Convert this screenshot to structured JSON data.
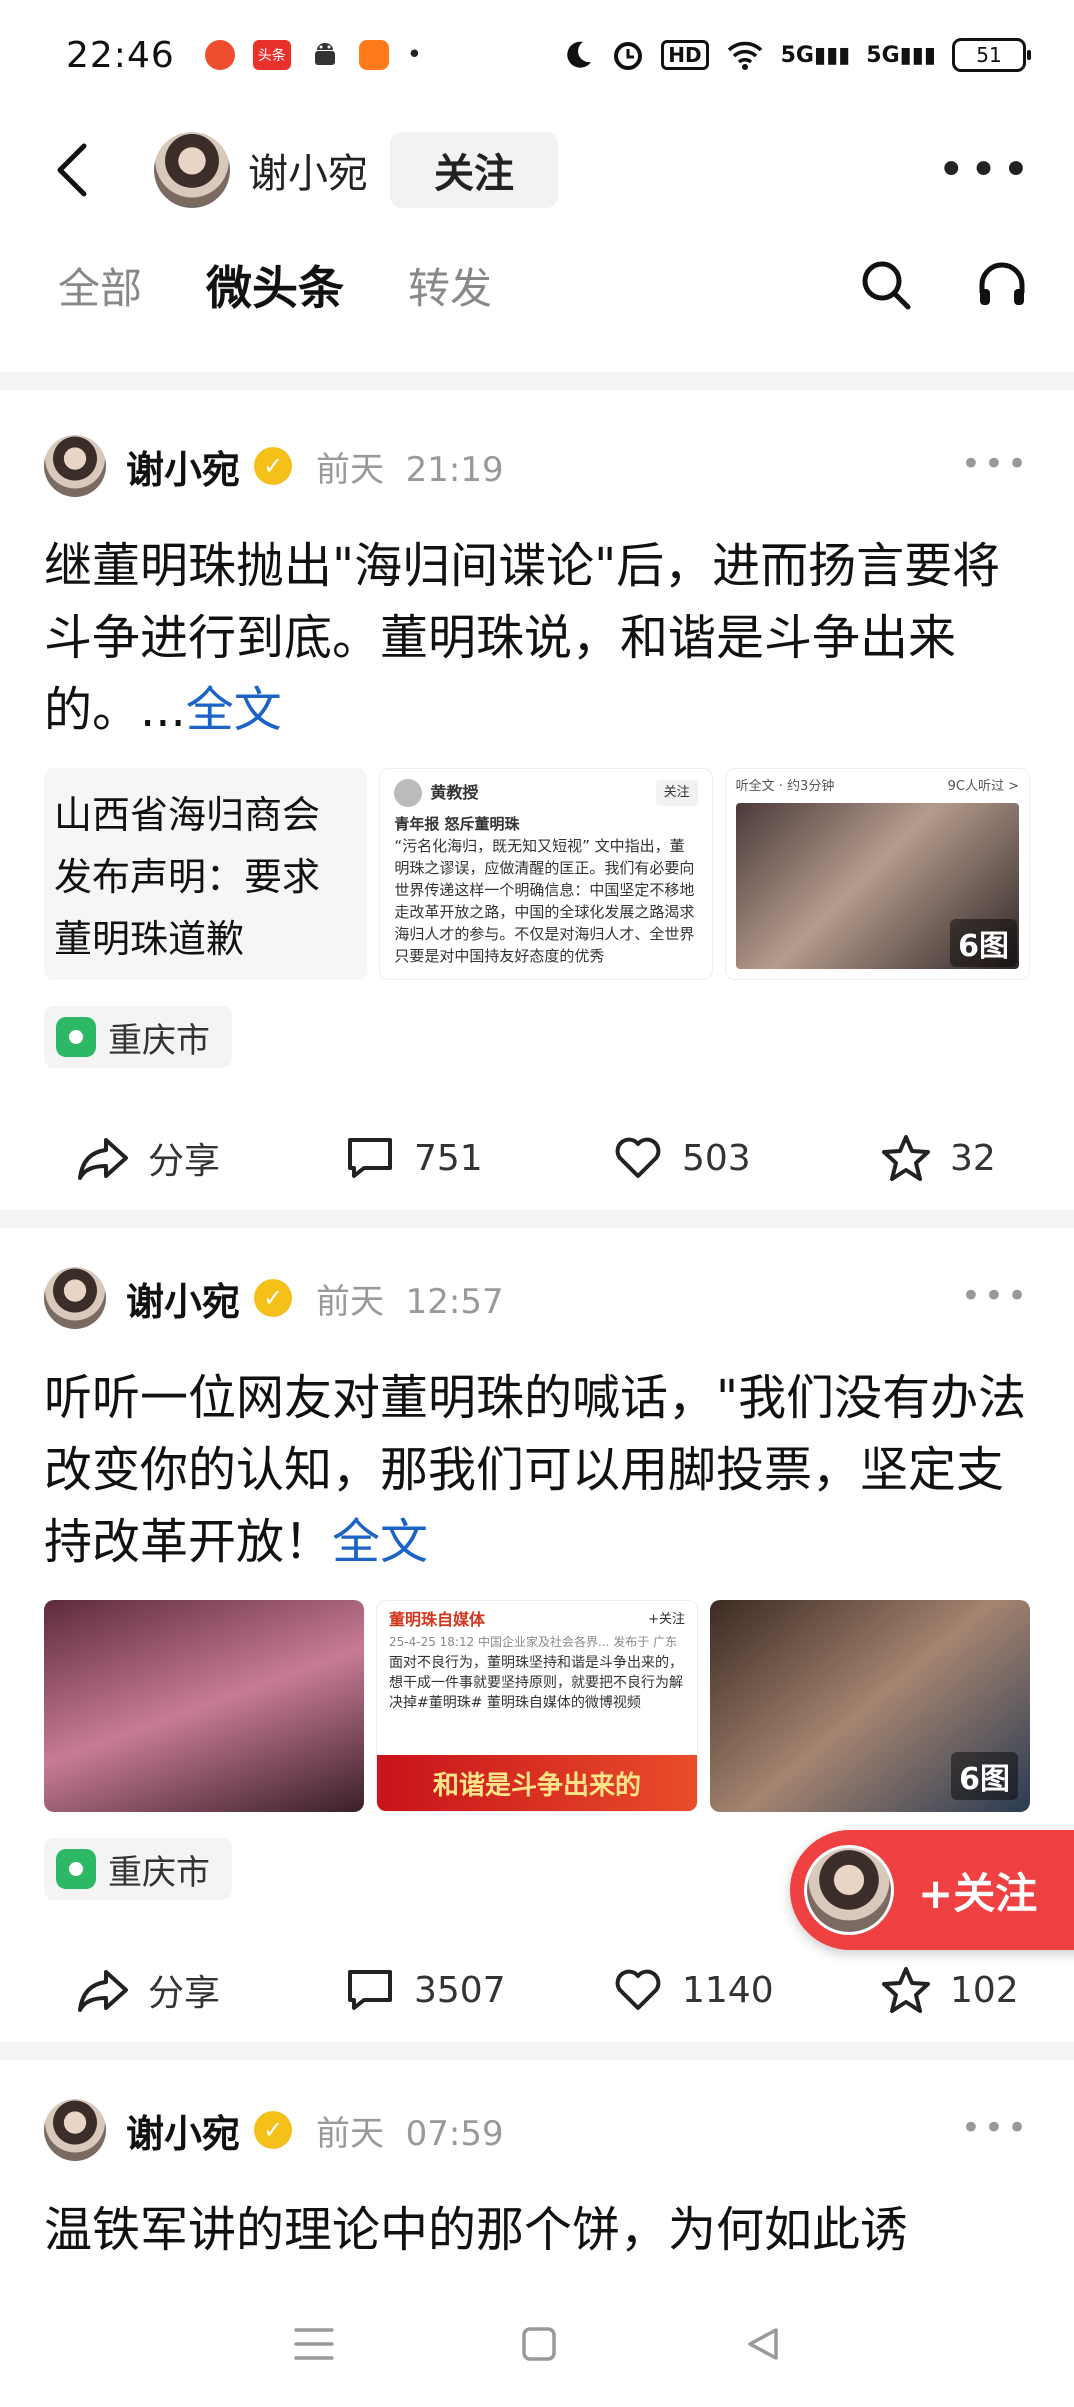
{
  "status_bar": {
    "time": "22:46",
    "network_label": "HD",
    "signal1": "5G",
    "signal2": "5G",
    "battery": "51",
    "app_badge": "头条"
  },
  "header": {
    "name": "谢小宛",
    "follow_label": "关注",
    "more_icon": "more-icon"
  },
  "tabs": [
    {
      "label": "全部",
      "active": false
    },
    {
      "label": "微头条",
      "active": true
    },
    {
      "label": "转发",
      "active": false
    }
  ],
  "posts": [
    {
      "author": "谢小宛",
      "verified_mark": "✓",
      "date": "前天",
      "time": "21:19",
      "text": "继董明珠抛出\"海归间谍论\"后，进而扬言要将斗争进行到底。董明珠说，和谐是斗争出来的。...",
      "full_label": "全文",
      "image1_text": "山西省海归商会发布声明：要求董明珠道歉",
      "image2": {
        "name": "黄教授",
        "follow": "关注",
        "headline": "青年报 怒斥董明珠",
        "body": "“污名化海归，既无知又短视” 文中指出，董明珠之谬误，应做清醒的匡正。我们有必要向世界传递这样一个明确信息：中国坚定不移地走改革开放之路，中国的全球化发展之路渴求海归人才的参与。不仅是对海归人才、全世界只要是对中国持友好态度的优秀"
      },
      "image3": {
        "top_left": "听全文 · 约3分钟",
        "top_right": "9C人听过 >",
        "count": "6图"
      },
      "location": "重庆市",
      "share_label": "分享",
      "comments": "751",
      "likes": "503",
      "favorites": "32"
    },
    {
      "author": "谢小宛",
      "verified_mark": "✓",
      "date": "前天",
      "time": "12:57",
      "text": "听听一位网友对董明珠的喊话，\"我们没有办法改变你的认知，那我们可以用脚投票，坚定支持改革开放！",
      "full_label": "全文",
      "image2": {
        "name": "董明珠自媒体",
        "follow": "+关注",
        "meta": "25-4-25 18:12 中国企业家及社会各界... 发布于 广东",
        "body": "面对不良行为，董明珠坚持和谐是斗争出来的，想干成一件事就要坚持原则，就要把不良行为解决掉#董明珠# 董明珠自媒体的微博视频",
        "banner": "和谐是斗争出来的"
      },
      "image3": {
        "count": "6图"
      },
      "location": "重庆市",
      "share_label": "分享",
      "comments": "3507",
      "likes": "1140",
      "favorites": "102"
    },
    {
      "author": "谢小宛",
      "verified_mark": "✓",
      "date": "前天",
      "time": "07:59",
      "text": "温铁军讲的理论中的那个饼，为何如此诱"
    }
  ],
  "float_follow": {
    "label": "+关注"
  },
  "colors": {
    "accent_red": "#f04142",
    "link_blue": "#1b63c7",
    "verified_yellow": "#f5c019",
    "location_green": "#2db866"
  }
}
